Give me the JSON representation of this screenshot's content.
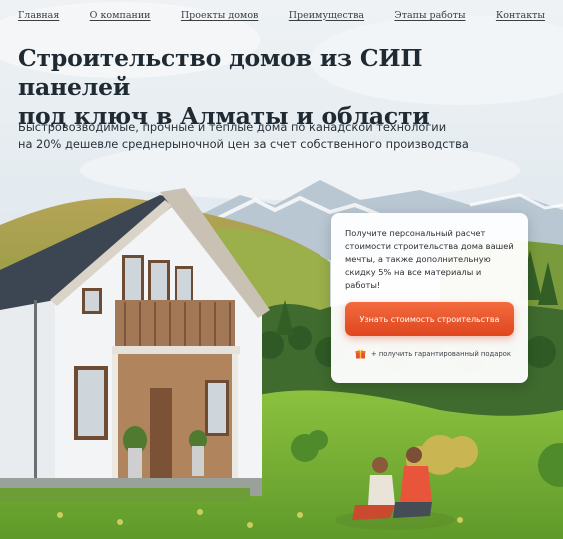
{
  "nav": {
    "items": [
      {
        "label": "Главная"
      },
      {
        "label": "О компании"
      },
      {
        "label": "Проекты домов"
      },
      {
        "label": "Преимущества"
      },
      {
        "label": "Этапы работы"
      },
      {
        "label": "Контакты"
      }
    ]
  },
  "hero": {
    "headline_line1": "Строительство домов из СИП панелей",
    "headline_line2": "под ключ в Алматы и области",
    "sub_line1": "Быстровозводимые, прочные и теплые дома по канадской технологии",
    "sub_line2": "на 20% дешевле среднерыночной цен за счет собственного производства"
  },
  "offer": {
    "text": "Получите персональный расчет стоимости строительства дома вашей мечты, а также дополнительную скидку 5% на все материалы и работы!",
    "button_label": "Узнать стоимость строительства",
    "gift_text": "+ получить гарантированный подарок",
    "gift_icon": "gift-icon"
  },
  "colors": {
    "cta": "#e8532a",
    "headline": "#1f2a33",
    "grass": "#7fb53a",
    "sky": "#dfe8ee"
  }
}
